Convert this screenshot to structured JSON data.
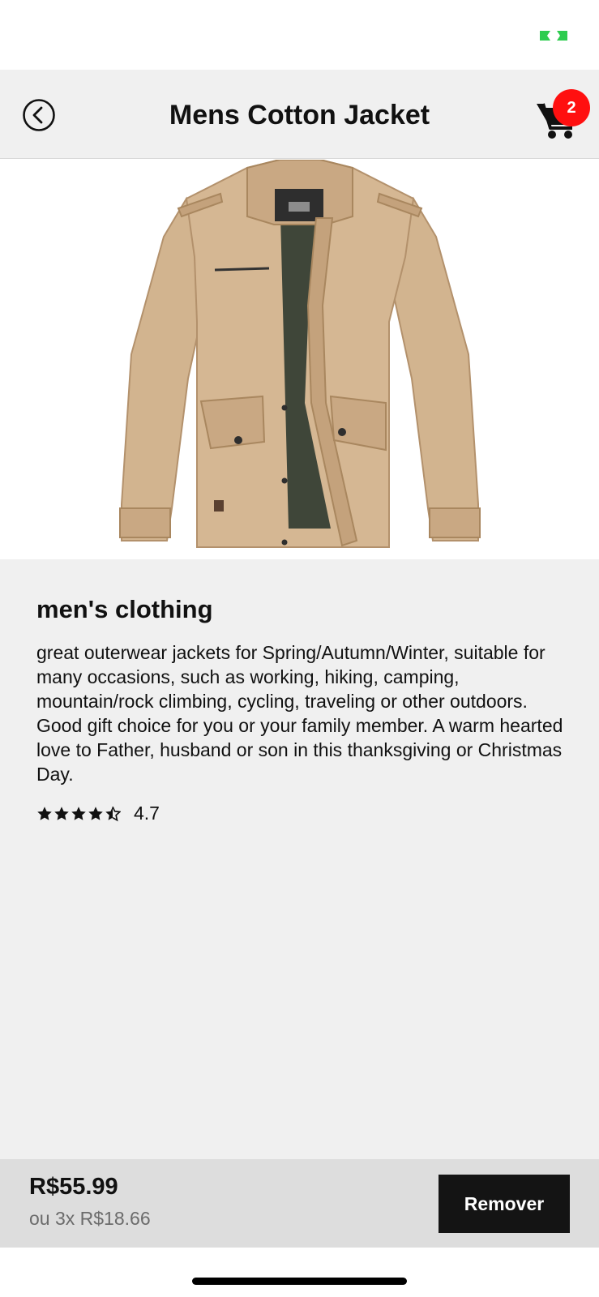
{
  "status_bar": {
    "indicator_color": "#2ecc4f"
  },
  "header": {
    "title": "Mens Cotton Jacket",
    "back_icon": "chevron-left-circle-icon",
    "cart_icon": "shopping-cart-icon",
    "cart_count": "2",
    "badge_color": "#ff1010"
  },
  "product": {
    "image_subject": "tan cotton jacket",
    "category": "men's clothing",
    "description": "great outerwear jackets for Spring/Autumn/Winter, suitable for many occasions, such as working, hiking, camping, mountain/rock climbing, cycling, traveling or other outdoors. Good gift choice for you or your family member. A warm hearted love to Father, husband or son in this thanksgiving or Christmas Day.",
    "rating": "4.7",
    "rating_stars": 4.7
  },
  "footer": {
    "price": "R$55.99",
    "installments": "ou 3x R$18.66",
    "remove_label": "Remover"
  }
}
